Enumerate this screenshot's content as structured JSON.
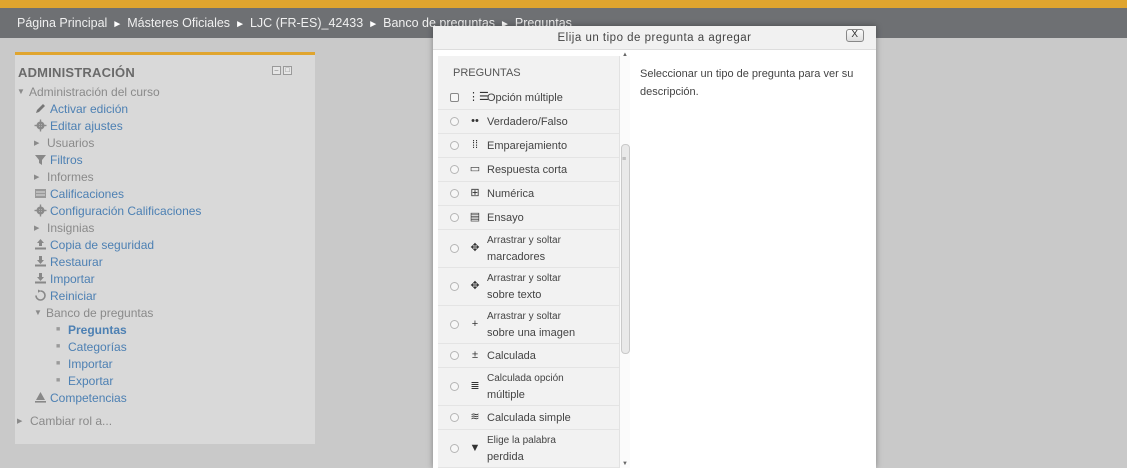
{
  "colors": {
    "accent": "#e0a52f",
    "link": "#4d80b3",
    "breadcrumb_bg": "#6e7073"
  },
  "breadcrumb": {
    "items": [
      "Página Principal",
      "Másteres Oficiales",
      "LJC (FR-ES)_42433",
      "Banco de preguntas",
      "Preguntas"
    ],
    "separator": "►"
  },
  "admin": {
    "title": "ADMINISTRACIÓN",
    "course_admin": "Administración del curso",
    "items": [
      {
        "label": "Activar edición",
        "icon": "pencil-icon"
      },
      {
        "label": "Editar ajustes",
        "icon": "gear-icon"
      },
      {
        "label": "Usuarios",
        "icon": "caret-right-icon"
      },
      {
        "label": "Filtros",
        "icon": "filter-icon"
      },
      {
        "label": "Informes",
        "icon": "caret-right-icon"
      },
      {
        "label": "Calificaciones",
        "icon": "table-icon"
      },
      {
        "label": "Configuración Calificaciones",
        "icon": "gear-icon"
      },
      {
        "label": "Insignias",
        "icon": "caret-right-icon"
      },
      {
        "label": "Copia de seguridad",
        "icon": "upload-icon"
      },
      {
        "label": "Restaurar",
        "icon": "download-icon"
      },
      {
        "label": "Importar",
        "icon": "download-icon"
      },
      {
        "label": "Reiniciar",
        "icon": "reset-icon"
      },
      {
        "label": "Banco de preguntas",
        "icon": "caret-down-icon"
      }
    ],
    "bank_items": [
      "Preguntas",
      "Categorías",
      "Importar",
      "Exportar"
    ],
    "competencias": "Competencias",
    "switch_role": "Cambiar rol a..."
  },
  "modal": {
    "title": "Elija un tipo de pregunta a agregar",
    "close": "X",
    "section_heading": "PREGUNTAS",
    "description": "Seleccionar un tipo de pregunta para ver su descripción.",
    "options": [
      {
        "lines": [
          "Opción múltiple"
        ],
        "icon": "multichoice-icon"
      },
      {
        "lines": [
          "Verdadero/Falso"
        ],
        "icon": "truefalse-icon"
      },
      {
        "lines": [
          "Emparejamiento"
        ],
        "icon": "match-icon"
      },
      {
        "lines": [
          "Respuesta corta"
        ],
        "icon": "shortanswer-icon"
      },
      {
        "lines": [
          "Numérica"
        ],
        "icon": "numerical-icon"
      },
      {
        "lines": [
          "Ensayo"
        ],
        "icon": "essay-icon"
      },
      {
        "lines": [
          "Arrastrar y soltar",
          "marcadores"
        ],
        "icon": "ddmarker-icon"
      },
      {
        "lines": [
          "Arrastrar y soltar",
          "sobre texto"
        ],
        "icon": "ddwtos-icon"
      },
      {
        "lines": [
          "Arrastrar y soltar",
          "sobre una imagen"
        ],
        "icon": "ddimage-icon"
      },
      {
        "lines": [
          "Calculada"
        ],
        "icon": "calculated-icon"
      },
      {
        "lines": [
          "Calculada opción",
          "múltiple"
        ],
        "icon": "calcmulti-icon"
      },
      {
        "lines": [
          "Calculada simple"
        ],
        "icon": "calcsimple-icon"
      },
      {
        "lines": [
          "Elige la palabra",
          "perdida"
        ],
        "icon": "gapselect-icon"
      }
    ]
  }
}
